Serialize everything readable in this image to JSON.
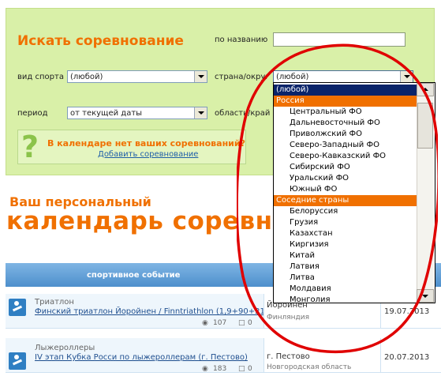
{
  "search": {
    "title": "Искать соревнование",
    "by_name_label": "по названию",
    "name_value": "",
    "sport_label": "вид спорта",
    "sport_value": "(любой)",
    "country_label": "страна/округ",
    "country_value": "(любой)",
    "period_label": "период",
    "period_value": "от текущей даты",
    "region_label": "область/край"
  },
  "add_box": {
    "question": "В календаре нет ваших соревнований?",
    "link": "Добавить соревнование"
  },
  "calendar": {
    "subtitle": "Ваш персональный",
    "title": "календарь соревнований"
  },
  "table": {
    "header_event": "спортивное событие",
    "rows": [
      {
        "sport": "Триатлон",
        "event": "Финский триатлон Йоройнен / Finntriathlon (1,9+90+21)",
        "views": "107",
        "comments": "0",
        "place": "Йороинен",
        "region": "Финляндия",
        "date": "19.07.2013"
      },
      {
        "sport": "Лыжероллеры",
        "event": "IV этап Кубка Росси по лыжероллерам (г. Пестово)",
        "views": "183",
        "comments": "0",
        "place": "г. Пестово",
        "region": "Новгородская область",
        "date": "20.07.2013"
      }
    ]
  },
  "dropdown": {
    "options": [
      {
        "label": "(любой)",
        "kind": "selected"
      },
      {
        "label": "Россия",
        "kind": "group"
      },
      {
        "label": "Центральный ФО",
        "kind": "item"
      },
      {
        "label": "Дальневосточный ФО",
        "kind": "item"
      },
      {
        "label": "Приволжский ФО",
        "kind": "item"
      },
      {
        "label": "Северо-Западный ФО",
        "kind": "item"
      },
      {
        "label": "Северо-Кавказский ФО",
        "kind": "item"
      },
      {
        "label": "Сибирский ФО",
        "kind": "item"
      },
      {
        "label": "Уральский ФО",
        "kind": "item"
      },
      {
        "label": "Южный ФО",
        "kind": "item"
      },
      {
        "label": "Соседние страны",
        "kind": "group"
      },
      {
        "label": "Белоруссия",
        "kind": "item"
      },
      {
        "label": "Грузия",
        "kind": "item"
      },
      {
        "label": "Казахстан",
        "kind": "item"
      },
      {
        "label": "Киргизия",
        "kind": "item"
      },
      {
        "label": "Китай",
        "kind": "item"
      },
      {
        "label": "Латвия",
        "kind": "item"
      },
      {
        "label": "Литва",
        "kind": "item"
      },
      {
        "label": "Молдавия",
        "kind": "item"
      },
      {
        "label": "Монголия",
        "kind": "item"
      }
    ]
  },
  "colors": {
    "accent": "#f07000",
    "panel": "#d9f0a8",
    "annotation": "#e00000",
    "selection": "#0a246a"
  }
}
